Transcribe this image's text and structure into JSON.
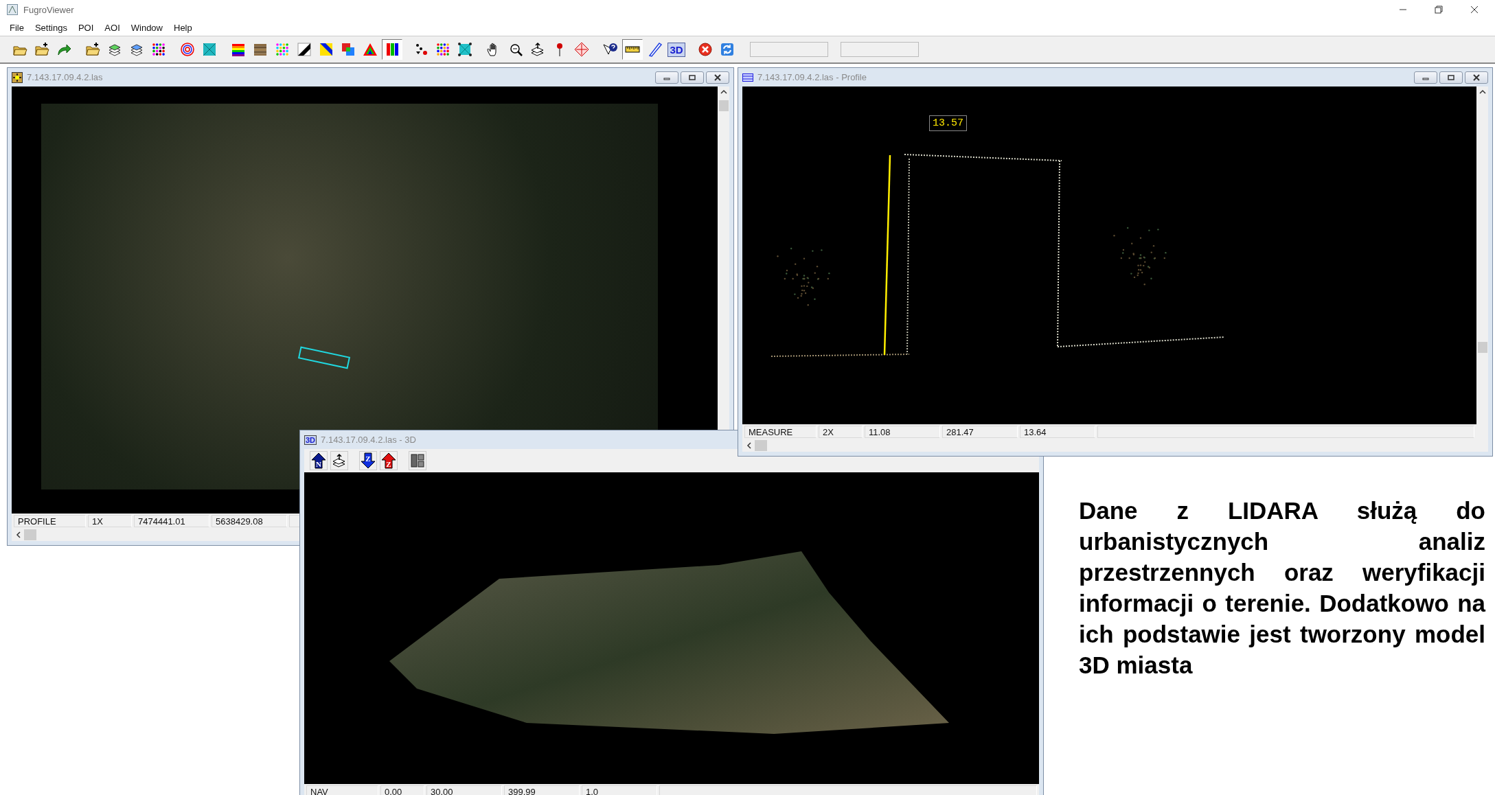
{
  "app": {
    "title": "FugroViewer"
  },
  "menu": [
    "File",
    "Settings",
    "POI",
    "AOI",
    "Window",
    "Help"
  ],
  "toolbar": [
    [
      {
        "selected": false
      },
      {
        "selected": false
      },
      {
        "selected": false
      }
    ],
    [
      {
        "selected": false
      },
      {
        "selected": false
      },
      {
        "selected": false
      },
      {
        "selected": false
      }
    ],
    [
      {
        "selected": false
      },
      {
        "selected": false
      }
    ],
    [
      {
        "selected": false
      },
      {
        "selected": false
      },
      {
        "selected": false
      },
      {
        "selected": false
      },
      {
        "selected": false
      },
      {
        "selected": false
      },
      {
        "selected": false
      },
      {
        "selected": true
      }
    ],
    [
      {
        "selected": false
      },
      {
        "selected": false
      },
      {
        "selected": false
      }
    ],
    [
      {
        "selected": false
      },
      {
        "selected": false
      },
      {
        "selected": false
      },
      {
        "selected": false
      },
      {
        "selected": false
      }
    ],
    [
      {
        "selected": false
      },
      {
        "selected": true
      },
      {
        "selected": false
      },
      {
        "selected": false,
        "label": "3D"
      }
    ],
    [
      {
        "selected": false
      },
      {
        "selected": false
      }
    ]
  ],
  "windows": [
    {
      "kind": "map",
      "title": "7.143.17.09.4.2.las",
      "status": [
        "PROFILE",
        "1X",
        "7474441.01",
        "5638429.08"
      ]
    },
    {
      "kind": "profile",
      "title": "7.143.17.09.4.2.las - Profile",
      "measurement": "13.57",
      "status": [
        "MEASURE",
        "2X",
        "11.08",
        "281.47",
        "13.64"
      ]
    },
    {
      "kind": "scene",
      "title": "7.143.17.09.4.2.las - 3D",
      "icon_label": "3D",
      "tool_letters": [
        "N",
        "Z",
        "Z"
      ],
      "status": [
        "NAV",
        "0.00",
        "30.00",
        "399.99",
        "1.0"
      ]
    }
  ],
  "caption": "Dane z LIDARA służą do urbanistycznych analiz przestrzennych oraz weryfikacji informacji o terenie. Dodatkowo na ich podstawie jest tworzony model 3D miasta"
}
